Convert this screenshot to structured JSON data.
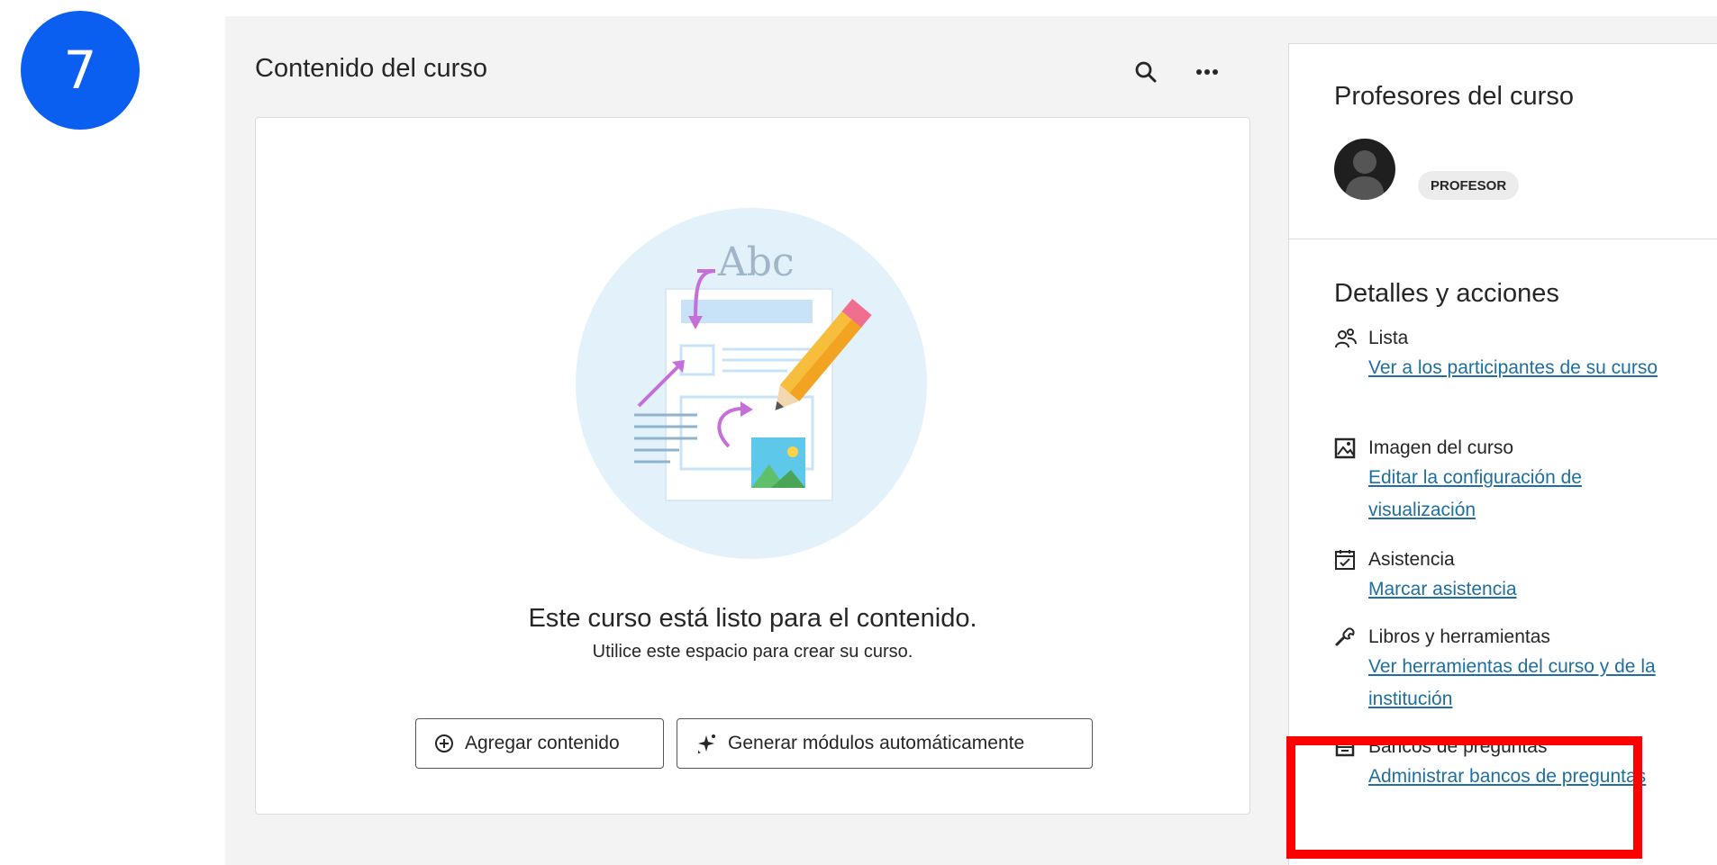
{
  "step_number": "7",
  "content": {
    "title": "Contenido del curso",
    "empty_title": "Este curso está listo para el contenido.",
    "empty_subtitle": "Utilice este espacio para crear su curso.",
    "illustration_text": "Abc",
    "add_content_label": "Agregar contenido",
    "generate_modules_label": "Generar módulos automáticamente"
  },
  "sidebar": {
    "instructors_title": "Profesores del curso",
    "role_badge": "PROFESOR",
    "details_title": "Detalles y acciones",
    "actions": [
      {
        "title": "Lista",
        "link": "Ver a los participantes de su curso",
        "icon": "roster-icon"
      },
      {
        "title": "Imagen del curso",
        "link": "Editar la configuración de visualización",
        "icon": "image-icon"
      },
      {
        "title": "Asistencia",
        "link": "Marcar asistencia",
        "icon": "attendance-icon"
      },
      {
        "title": "Libros y herramientas",
        "link": "Ver herramientas del curso y de la institución",
        "icon": "wrench-icon"
      },
      {
        "title": "Bancos de preguntas",
        "link": "Administrar bancos de preguntas",
        "icon": "question-bank-icon"
      }
    ]
  },
  "colors": {
    "step_badge": "#0b5ff0",
    "link": "#1e6fa0",
    "highlight": "#ff0000"
  }
}
